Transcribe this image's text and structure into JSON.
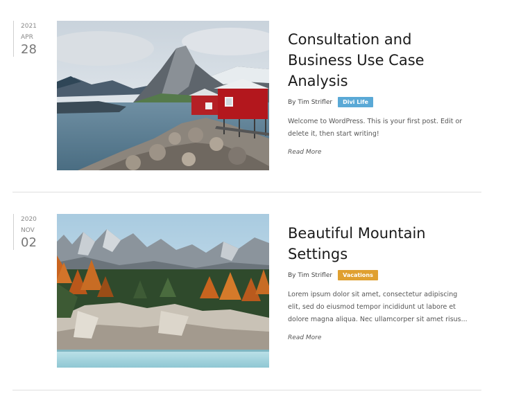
{
  "posts": [
    {
      "year": "2021",
      "month": "APR",
      "day": "28",
      "title": "Consultation and Business Use Case Analysis",
      "author": "By Tim Strifler",
      "category": "Divi Life",
      "category_color": "#5aa9d6",
      "excerpt": "Welcome to WordPress. This is your first post. Edit or delete it, then start writing!",
      "read_more": "Read More",
      "image": "lake-red-cabin-mountain-photo"
    },
    {
      "year": "2020",
      "month": "NOV",
      "day": "02",
      "title": "Beautiful Mountain Settings",
      "author": "By Tim Strifler",
      "category": "Vacations",
      "category_color": "#e0a030",
      "excerpt": "Lorem ipsum dolor sit amet, consectetur adipiscing elit, sed do eiusmod tempor incididunt ut labore et dolore magna aliqua. Nec ullamcorper sit amet risus...",
      "read_more": "Read More",
      "image": "autumn-mountain-forest-photo"
    }
  ]
}
